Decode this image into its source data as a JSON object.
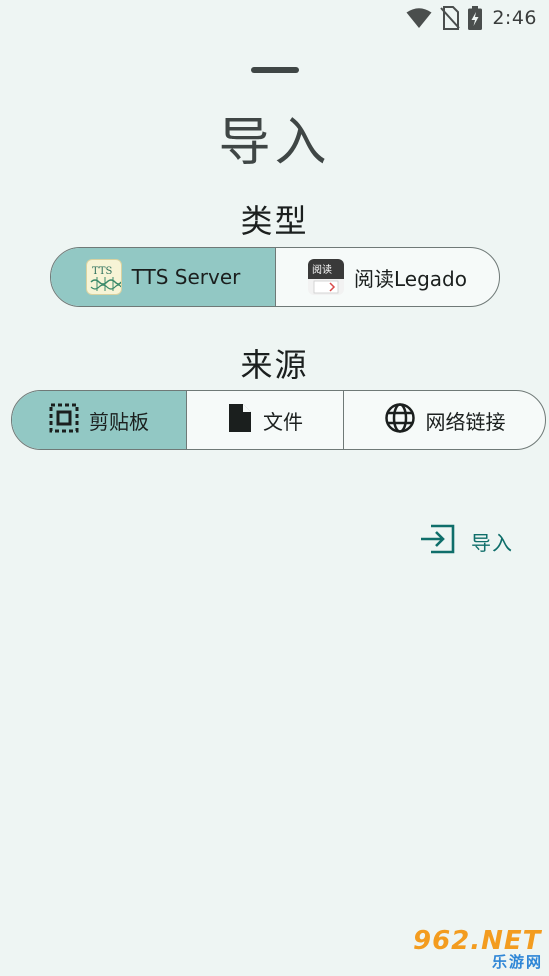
{
  "status_bar": {
    "time": "2:46",
    "icons": [
      "wifi-icon",
      "no-sim-icon",
      "battery-charging-icon"
    ]
  },
  "sheet": {
    "title": "导入"
  },
  "type_section": {
    "label": "类型",
    "options": [
      {
        "label": "TTS Server",
        "icon": "tts-server-app-icon",
        "selected": true
      },
      {
        "label": "阅读Legado",
        "icon": "legado-app-icon",
        "selected": false
      }
    ]
  },
  "source_section": {
    "label": "来源",
    "options": [
      {
        "label": "剪贴板",
        "icon": "clipboard-select-icon",
        "selected": true
      },
      {
        "label": "文件",
        "icon": "file-icon",
        "selected": false
      },
      {
        "label": "网络链接",
        "icon": "globe-icon",
        "selected": false
      }
    ]
  },
  "import_action": {
    "label": "导入",
    "icon": "login-arrow-icon"
  },
  "watermark": {
    "top": "962.NET",
    "bottom": "乐游网"
  },
  "colors": {
    "background": "#eef5f3",
    "selected_segment": "#92c8c4",
    "accent": "#0f6e6a",
    "outline": "#6f7977"
  }
}
